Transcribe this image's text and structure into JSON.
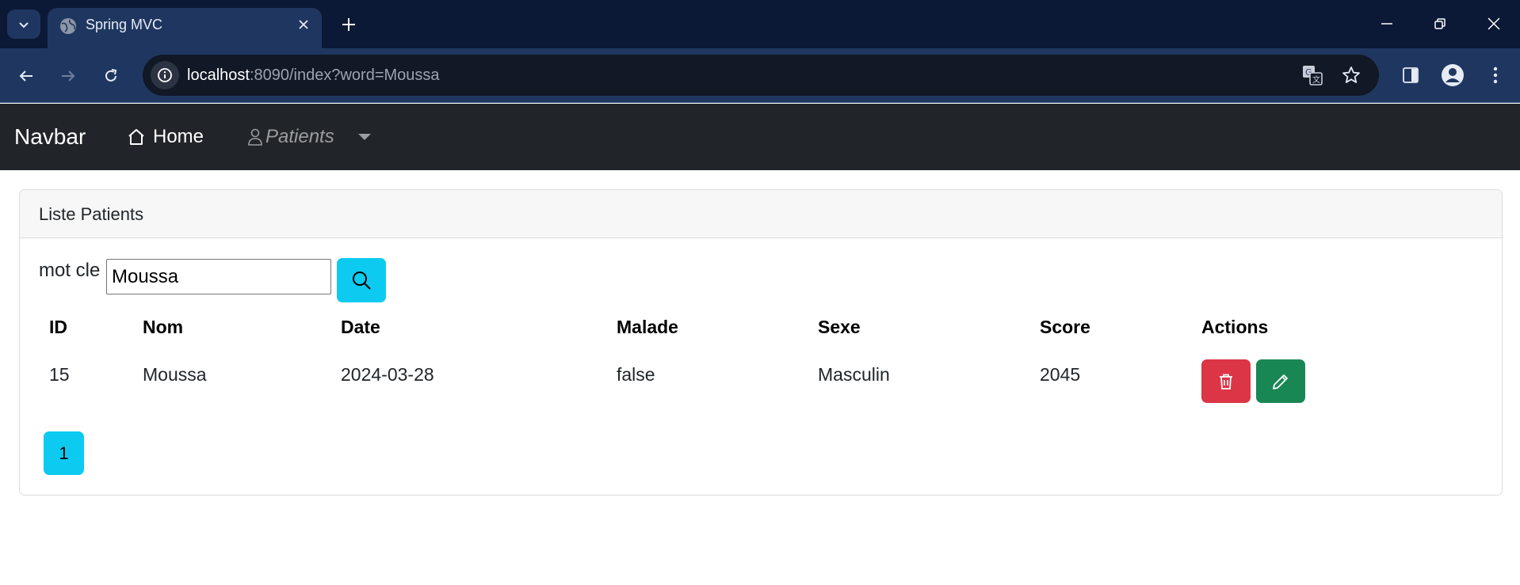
{
  "browser": {
    "tab_title": "Spring MVC",
    "url_host": "localhost",
    "url_rest": ":8090/index?word=Moussa"
  },
  "navbar": {
    "brand": "Navbar",
    "home_label": "Home",
    "patients_label": "Patients"
  },
  "card": {
    "title": "Liste Patients"
  },
  "search": {
    "label": "mot cle",
    "value": "Moussa"
  },
  "table": {
    "headers": [
      "ID",
      "Nom",
      "Date",
      "Malade",
      "Sexe",
      "Score",
      "Actions"
    ],
    "rows": [
      [
        "15",
        "Moussa",
        "2024-03-28",
        "false",
        "Masculin",
        "2045"
      ]
    ]
  },
  "pagination": {
    "pages": [
      "1"
    ]
  },
  "colors": {
    "search_button": "#0dcaf0",
    "delete_button": "#dc3545",
    "edit_button": "#198754",
    "navbar_bg": "#212529"
  },
  "icons": {
    "tab_list": "chevron-down-icon",
    "favicon": "globe-icon",
    "close_tab": "close-icon",
    "new_tab": "plus-icon",
    "back": "arrow-left-icon",
    "forward": "arrow-right-icon",
    "reload": "reload-icon",
    "site_info": "info-icon",
    "translate": "translate-icon",
    "bookmark": "star-icon",
    "side_panel": "side-panel-icon",
    "profile": "profile-icon",
    "menu": "kebab-menu-icon",
    "home": "house-icon",
    "patients": "person-icon",
    "search": "search-icon",
    "delete": "trash-icon",
    "edit": "pencil-icon"
  }
}
